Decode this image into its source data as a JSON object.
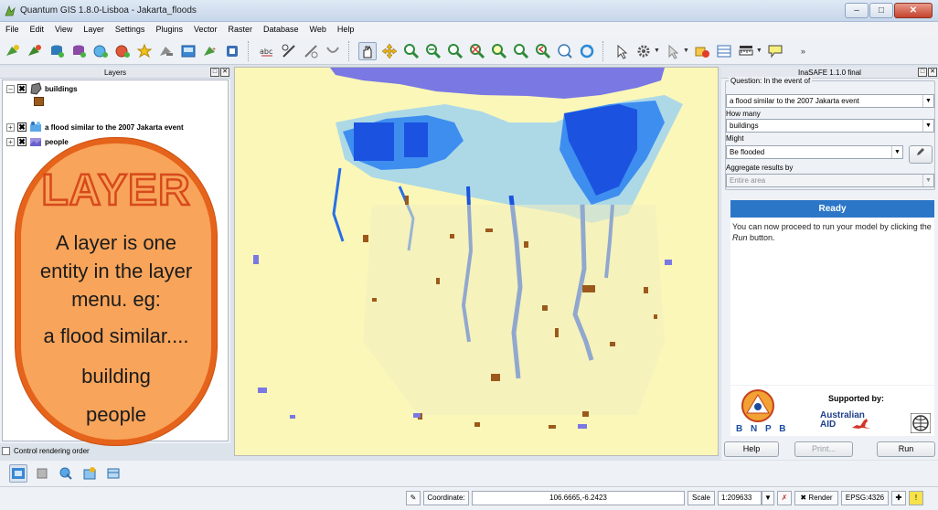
{
  "window": {
    "title": "Quantum GIS 1.8.0-Lisboa - Jakarta_floods",
    "controls": [
      "minimize",
      "maximize",
      "close"
    ]
  },
  "menu": [
    "File",
    "Edit",
    "View",
    "Layer",
    "Settings",
    "Plugins",
    "Vector",
    "Raster",
    "Database",
    "Web",
    "Help"
  ],
  "toolbar": {
    "icons": [
      "add-vector-layer-icon",
      "add-raster-layer-icon",
      "add-postgis-layer-icon",
      "add-spatialite-layer-icon",
      "add-wms-layer-icon",
      "add-wfs-layer-icon",
      "new-shapefile-icon",
      "remove-layer-icon",
      "composer-icon",
      "add-delimited-text-icon",
      "inasafe-icon",
      "label-icon",
      "digitize-icon",
      "node-tool-icon",
      "pan-icon",
      "pan-to-selection-icon",
      "zoom-in-icon",
      "zoom-out-icon",
      "zoom-full-icon",
      "zoom-selection-icon",
      "zoom-layer-icon",
      "zoom-native-icon",
      "zoom-last-icon",
      "zoom-next-icon",
      "refresh-icon",
      "identify-icon",
      "settings-icon",
      "select-icon",
      "deselect-icon",
      "attribute-table-icon",
      "measure-icon",
      "annotation-icon"
    ]
  },
  "layers_panel": {
    "title": "Layers",
    "layers": [
      {
        "name": "buildings",
        "checked": true,
        "expanded": true
      },
      {
        "name": "a flood similar to  the 2007 Jakarta event",
        "checked": true,
        "expanded": false
      },
      {
        "name": "people",
        "checked": true,
        "expanded": false
      }
    ],
    "control_rendering_order": "Control rendering order"
  },
  "callout": {
    "title": "LAYER",
    "lines": [
      "A layer is one",
      "entity in the layer",
      "menu. eg:",
      "a flood similar....",
      "building",
      "people"
    ]
  },
  "inasafe": {
    "title": "InaSAFE 1.1.0 final",
    "question_label": "Question: In the event of",
    "hazard": "a flood similar to  the 2007 Jakarta event",
    "how_many_label": "How many",
    "exposure": "buildings",
    "might_label": "Might",
    "function": "Be flooded",
    "aggregate_label": "Aggregate results by",
    "aggregate_value": "Entire area",
    "status": "Ready",
    "message_before": "You can now proceed to run your model by clicking the ",
    "message_run": "Run",
    "message_after": " button.",
    "supported_by": "Supported by:",
    "bnpb": "B N P B",
    "australian_aid": [
      "Australian",
      "AID"
    ],
    "buttons": {
      "help": "Help",
      "print": "Print...",
      "run": "Run"
    }
  },
  "statusbar": {
    "coordinate_label": "Coordinate:",
    "coordinate_value": "106.6665,-6.2423",
    "scale_label": "Scale",
    "scale_value": "1:209633",
    "render_label": "Render",
    "render_checked": true,
    "crs": "EPSG:4326"
  },
  "colors": {
    "map_background": "#fbf7b8",
    "sea": "#7a78e3",
    "flood_deep": "#1b53e0",
    "flood_mid": "#3e8ef0",
    "flood_light": "#9fd4ef",
    "buildings": "#9b5a1b",
    "callout_fill": "#f8a45a",
    "callout_border": "#e5631b",
    "ready": "#2c76c8"
  }
}
